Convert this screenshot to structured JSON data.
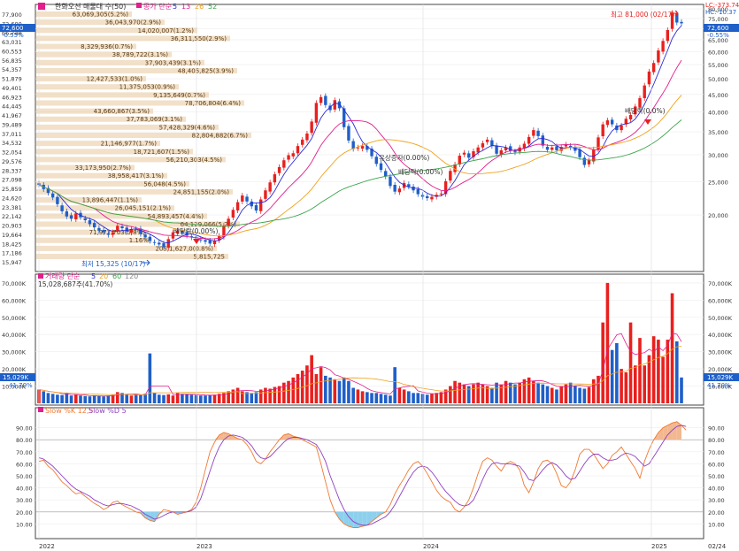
{
  "colors": {
    "up": "#e8201e",
    "down": "#1f5fc8",
    "ma5": "#2a2ad8",
    "ma13": "#e21d8c",
    "ma26": "#f0a01a",
    "ma52": "#3aa34a",
    "volbar": "#e8c79a",
    "stochK": "#f07830",
    "stochD": "#9040c0",
    "over": "#f2b890",
    "under": "#8cd0ee"
  },
  "header": {
    "title": "한화오션 매물대 수(50)",
    "ma_label": "종가 단순",
    "ma_periods": [
      "5",
      "13",
      "26",
      "52"
    ],
    "top_right_lc": "LC:-373.74",
    "top_right_hc": "HC:-10.37",
    "last_price": "72,600",
    "last_change": "-0.55%"
  },
  "price_axis": {
    "left": [
      "77,900",
      "72,600",
      "66,748",
      "63,031",
      "60,553",
      "56,835",
      "54,357",
      "51,879",
      "49,401",
      "46,923",
      "44,445",
      "41,967",
      "39,489",
      "37,011",
      "34,532",
      "32,054",
      "29,576",
      "28,337",
      "27,098",
      "25,859",
      "24,620",
      "23,381",
      "22,142",
      "20,903",
      "19,664",
      "18,425",
      "17,186",
      "15,947"
    ],
    "right": [
      "80,000",
      "75,000",
      "70,000",
      "65,000",
      "60,000",
      "55,000",
      "50,000",
      "45,000",
      "40,000",
      "35,000",
      "30,000",
      "25,000",
      "20,000"
    ]
  },
  "volume_profile": [
    {
      "label": "63,069,305(5.2%)"
    },
    {
      "label": "36,043,970(2.9%)"
    },
    {
      "label": "14,020,007(1.2%)"
    },
    {
      "label": "36,311,550(2.9%)"
    },
    {
      "label": "8,329,936(0.7%)"
    },
    {
      "label": "38,789,722(3.1%)"
    },
    {
      "label": "37,903,439(3.1%)"
    },
    {
      "label": "48,405,825(3.9%)"
    },
    {
      "label": "12,427,533(1.0%)"
    },
    {
      "label": "11,375,053(0.9%)"
    },
    {
      "label": "9,135,649(0.7%)"
    },
    {
      "label": "78,706,804(6.4%)"
    },
    {
      "label": "43,660,867(3.5%)"
    },
    {
      "label": "37,783,069(3.1%)"
    },
    {
      "label": "57,428,329(4.6%)"
    },
    {
      "label": "82,804,882(6.7%)"
    },
    {
      "label": "21,146,977(1.7%)"
    },
    {
      "label": "18,721,607(1.5%)"
    },
    {
      "label": "56,210,303(4.5%)"
    },
    {
      "label": "33,173,950(2.7%)"
    },
    {
      "label": "38,958,417(3.1%)"
    },
    {
      "label": "56,048(4.5%)"
    },
    {
      "label": "24,851,155(2.0%)"
    },
    {
      "label": "13,896,447(1.1%)"
    },
    {
      "label": "26,045,151(2.1%)"
    },
    {
      "label": "54,893,457(4.4%)"
    },
    {
      "label": "64,129,066(5.2%)"
    },
    {
      "label": "71,977,703(5.8%)"
    },
    {
      "label": "1.16%"
    },
    {
      "label": "205,1,627,0(0.8%)"
    },
    {
      "label": "5,815,725"
    }
  ],
  "annotations": {
    "high": "최고 81,000 (02/17)",
    "low": "최저 15,325 (10/17)",
    "div1": "배당락(0.00%)",
    "div2": "배당락(0.0%)",
    "div3": "배당락(0.00%)",
    "rights": "유상증자(0.00%)"
  },
  "volume_panel": {
    "label": "거래량 단순",
    "ma_periods": [
      "5",
      "20",
      "60",
      "120"
    ],
    "current": "15,028,687주(41.70%)",
    "axis": [
      "70,000K",
      "60,000K",
      "50,000K",
      "40,000K",
      "30,000K",
      "20,000K",
      "10,000K"
    ],
    "last_value": "15,029K",
    "last_pct": "41.70%"
  },
  "stoch_panel": {
    "label_k": "Slow %K 12,5",
    "label_d": "Slow %D 5",
    "axis": [
      "90.00",
      "80.00",
      "70.00",
      "60.00",
      "50.00",
      "40.00",
      "30.00",
      "20.00",
      "10.00"
    ]
  },
  "x_axis": [
    "2022",
    "2023",
    "2024",
    "2025",
    "02/24"
  ],
  "chart_data": [
    {
      "type": "candlestick",
      "title": "한화오션",
      "series": [
        {
          "name": "MA5",
          "values": []
        },
        {
          "name": "MA13",
          "values": []
        },
        {
          "name": "MA26",
          "values": []
        },
        {
          "name": "MA52",
          "values": []
        }
      ],
      "x": [
        "2022",
        "2023",
        "2024",
        "2025"
      ],
      "ylim": [
        14000,
        81000
      ],
      "close": [
        24500,
        23800,
        23200,
        22500,
        21500,
        20500,
        19800,
        19500,
        20200,
        19700,
        19300,
        18800,
        18400,
        18000,
        17800,
        17500,
        17800,
        18600,
        18300,
        17900,
        18200,
        18100,
        17600,
        17200,
        16800,
        16600,
        16400,
        16100,
        17000,
        17800,
        18000,
        17700,
        17400,
        17200,
        17100,
        16900,
        16700,
        16500,
        16800,
        17400,
        18600,
        19500,
        20700,
        21800,
        22800,
        21900,
        21200,
        20600,
        22200,
        23600,
        24900,
        26300,
        27600,
        28900,
        29900,
        30300,
        31800,
        33200,
        34600,
        37500,
        42500,
        44200,
        41900,
        40500,
        43300,
        41000,
        36100,
        33000,
        31200,
        31500,
        31800,
        31000,
        29700,
        28200,
        27100,
        25900,
        24300,
        23400,
        23900,
        24800,
        24200,
        23600,
        23000,
        22600,
        22400,
        22600,
        22900,
        23100,
        25100,
        26900,
        28100,
        29800,
        30400,
        29400,
        30700,
        31500,
        32400,
        33200,
        31800,
        30200,
        30900,
        31500,
        30800,
        30500,
        31500,
        32300,
        33800,
        35400,
        34000,
        31900,
        31000,
        31500,
        30900,
        31600,
        32100,
        31500,
        30800,
        29500,
        28000,
        28900,
        31100,
        33700,
        36800,
        37800,
        36800,
        35400,
        36500,
        38200,
        39200,
        41500,
        43900,
        47800,
        52500,
        55600,
        60500,
        64500,
        69400,
        77900,
        73000,
        72600
      ],
      "volume_k": [
        8000,
        7000,
        6000,
        5500,
        5000,
        4800,
        6000,
        4500,
        5000,
        4500,
        4200,
        4000,
        4500,
        4300,
        4000,
        4500,
        4800,
        6500,
        6000,
        5000,
        4500,
        5000,
        4800,
        5500,
        29000,
        6000,
        5000,
        4800,
        5200,
        4500,
        6000,
        5500,
        5200,
        5000,
        4800,
        4500,
        4500,
        4800,
        5000,
        5500,
        6000,
        7000,
        8000,
        9000,
        7000,
        6500,
        6000,
        6500,
        8000,
        9000,
        8500,
        9500,
        10000,
        12000,
        13000,
        15000,
        17000,
        19000,
        22000,
        28000,
        17000,
        21000,
        16000,
        15000,
        14000,
        13000,
        15000,
        13000,
        9000,
        8000,
        7000,
        6500,
        6000,
        6000,
        5500,
        5000,
        4500,
        21000,
        9000,
        8000,
        7000,
        6000,
        6000,
        5500,
        5000,
        5500,
        6000,
        6500,
        8000,
        10000,
        13000,
        12000,
        11000,
        10000,
        11000,
        12000,
        11000,
        10000,
        9000,
        12000,
        11000,
        13000,
        12000,
        11000,
        12000,
        14000,
        15000,
        13000,
        12000,
        11000,
        10000,
        9000,
        8000,
        10000,
        11000,
        12000,
        10000,
        9000,
        8500,
        9500,
        14000,
        16000,
        47000,
        70000,
        31000,
        35000,
        20000,
        18000,
        47000,
        22000,
        38000,
        22000,
        28000,
        39000,
        37000,
        27000,
        37000,
        64000,
        36000,
        15029
      ],
      "stoch_k": [
        62,
        63,
        58,
        55,
        50,
        45,
        42,
        38,
        35,
        36,
        33,
        30,
        27,
        25,
        22,
        24,
        28,
        29,
        26,
        24,
        22,
        20,
        19,
        15,
        13,
        12,
        18,
        22,
        21,
        20,
        18,
        19,
        20,
        22,
        28,
        40,
        55,
        70,
        78,
        84,
        86,
        85,
        83,
        81,
        80,
        76,
        70,
        62,
        60,
        64,
        70,
        75,
        80,
        84,
        85,
        83,
        82,
        80,
        78,
        76,
        74,
        60,
        45,
        30,
        20,
        14,
        10,
        8,
        7,
        7,
        8,
        9,
        12,
        15,
        18,
        20,
        26,
        35,
        42,
        48,
        55,
        60,
        62,
        58,
        52,
        45,
        38,
        33,
        30,
        28,
        22,
        20,
        24,
        30,
        40,
        52,
        62,
        65,
        63,
        58,
        54,
        60,
        62,
        60,
        55,
        42,
        36,
        45,
        56,
        62,
        63,
        60,
        52,
        42,
        40,
        45,
        55,
        68,
        72,
        72,
        68,
        62,
        56,
        60,
        67,
        70,
        74,
        68,
        62,
        56,
        48,
        62,
        72,
        80,
        86,
        90,
        92,
        94,
        95,
        92,
        88
      ],
      "stoch_d": [
        65,
        64,
        61,
        58,
        54,
        50,
        46,
        42,
        39,
        37,
        35,
        33,
        30,
        28,
        26,
        25,
        26,
        27,
        27,
        26,
        25,
        23,
        21,
        18,
        16,
        14,
        15,
        17,
        19,
        20,
        20,
        20,
        20,
        21,
        24,
        31,
        42,
        54,
        65,
        74,
        80,
        83,
        84,
        83,
        82,
        79,
        75,
        69,
        65,
        64,
        66,
        70,
        74,
        78,
        81,
        82,
        82,
        81,
        80,
        78,
        76,
        70,
        62,
        50,
        40,
        30,
        22,
        16,
        12,
        10,
        9,
        9,
        10,
        12,
        14,
        16,
        20,
        26,
        33,
        40,
        47,
        53,
        57,
        58,
        57,
        53,
        48,
        42,
        37,
        33,
        29,
        26,
        25,
        26,
        30,
        38,
        47,
        55,
        60,
        61,
        60,
        60,
        60,
        59,
        58,
        53,
        47,
        46,
        50,
        55,
        59,
        61,
        59,
        55,
        50,
        47,
        48,
        54,
        60,
        65,
        68,
        68,
        65,
        63,
        63,
        64,
        67,
        69,
        68,
        66,
        62,
        58,
        60,
        66,
        72,
        78,
        84,
        88,
        91,
        92,
        91
      ]
    }
  ]
}
